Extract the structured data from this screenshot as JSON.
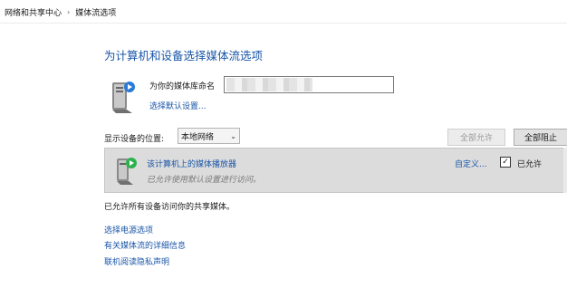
{
  "breadcrumb": {
    "items": [
      "网络和共享中心",
      "媒体流选项"
    ],
    "separator": "›"
  },
  "page_title": "为计算机和设备选择媒体流选项",
  "library": {
    "name_label": "为你的媒体库命名",
    "name_value": "",
    "choose_default_link": "选择默认设置..."
  },
  "location": {
    "label": "显示设备的位置:",
    "selected": "本地网络"
  },
  "buttons": {
    "allow_all": "全部允许",
    "block_all": "全部阻止"
  },
  "device": {
    "name": "该计算机上的媒体播放器",
    "description": "已允许使用默认设置进行访问。",
    "customize_link": "自定义...",
    "allowed_label": "已允许",
    "allowed_checked": true,
    "check_mark": "✓"
  },
  "status_text": "已允许所有设备访问你的共享媒体。",
  "links": [
    "选择电源选项",
    "有关媒体流的详细信息",
    "联机阅读隐私声明"
  ],
  "colors": {
    "link": "#1a56a8",
    "row_background": "#dcdcdc"
  }
}
